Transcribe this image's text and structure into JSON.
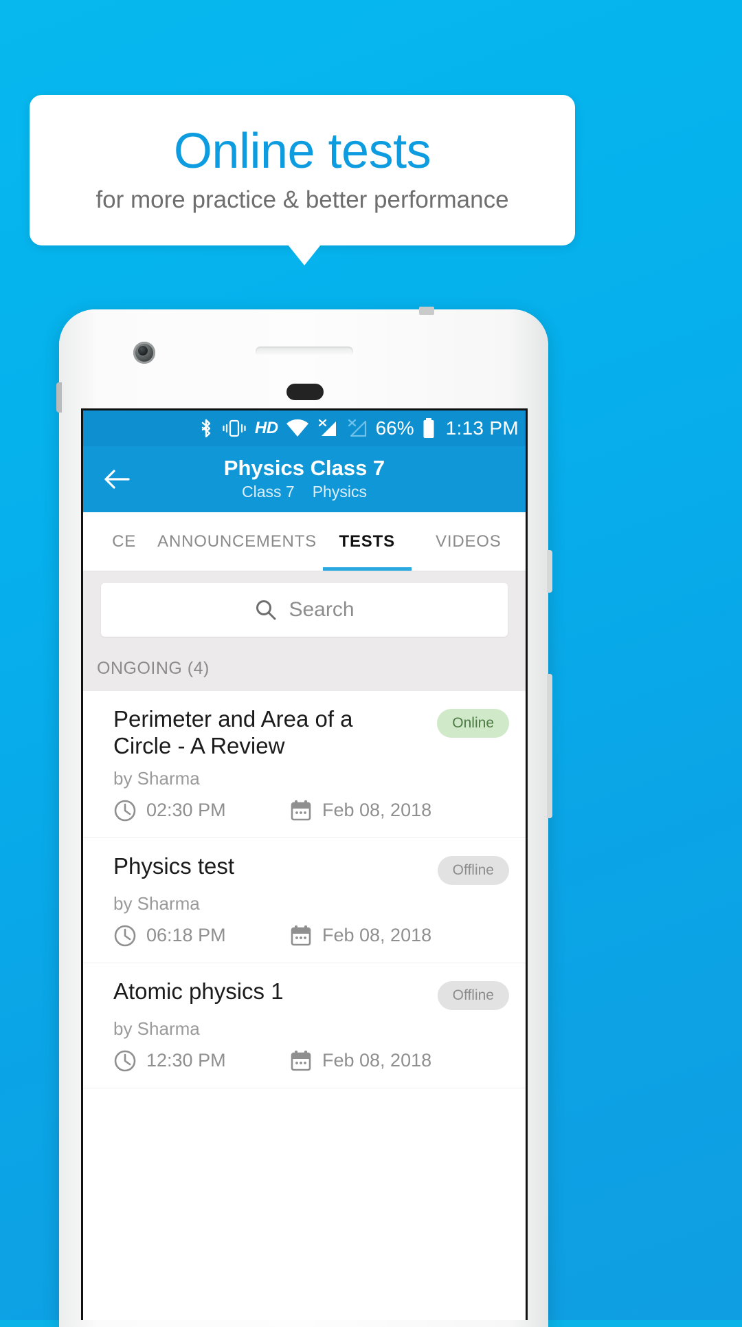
{
  "promo": {
    "title": "Online tests",
    "subtitle": "for more practice & better performance",
    "title_color": "#0d9ce0",
    "subtitle_color": "#6e6e6e",
    "background_color": "#06b4ec"
  },
  "status_bar": {
    "bluetooth_icon": "bluetooth-icon",
    "vibrate_icon": "vibrate-icon",
    "hd_label": "HD",
    "wifi_icon": "wifi-icon",
    "signal_1_icon": "signal-no-sim-icon",
    "signal_2_icon": "signal-no-sim-dim-icon",
    "battery_percent": "66%",
    "battery_icon": "battery-icon",
    "time": "1:13 PM",
    "background_color": "#0e8fd0"
  },
  "app_bar": {
    "back_icon": "back-arrow-icon",
    "title": "Physics Class 7",
    "subtitle_class": "Class 7",
    "subtitle_subject": "Physics",
    "background_color": "#1097d8"
  },
  "tabs": [
    {
      "label": "CE",
      "active": false
    },
    {
      "label": "ANNOUNCEMENTS",
      "active": false
    },
    {
      "label": "TESTS",
      "active": true
    },
    {
      "label": "VIDEOS",
      "active": false
    }
  ],
  "tabs_active_color": "#2aa9e0",
  "search": {
    "icon": "search-icon",
    "placeholder": "Search",
    "value": ""
  },
  "section": {
    "header": "ONGOING (4)"
  },
  "tests": [
    {
      "title": "Perimeter and Area of a Circle - A Review",
      "author": "by Sharma",
      "status": "Online",
      "status_kind": "online",
      "time": "02:30 PM",
      "date": "Feb 08, 2018",
      "clock_icon": "clock-icon",
      "calendar_icon": "calendar-icon"
    },
    {
      "title": "Physics test",
      "author": "by Sharma",
      "status": "Offline",
      "status_kind": "offline",
      "time": "06:18 PM",
      "date": "Feb 08, 2018",
      "clock_icon": "clock-icon",
      "calendar_icon": "calendar-icon"
    },
    {
      "title": "Atomic physics 1",
      "author": "by Sharma",
      "status": "Offline",
      "status_kind": "offline",
      "time": "12:30 PM",
      "date": "Feb 08, 2018",
      "clock_icon": "clock-icon",
      "calendar_icon": "calendar-icon"
    }
  ],
  "colors": {
    "badge_online_bg": "#cfe9c9",
    "badge_online_fg": "#4d7a44",
    "badge_offline_bg": "#e2e2e2",
    "badge_offline_fg": "#8d8d8d"
  }
}
